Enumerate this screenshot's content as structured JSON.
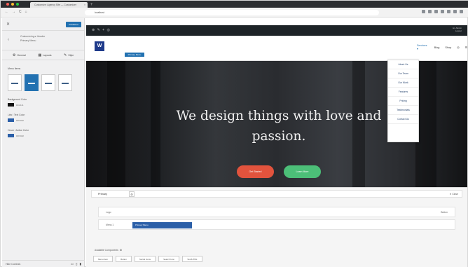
{
  "browser": {
    "tab_title": "Customize: Agency Site — Customizer",
    "tab_close": "×",
    "new_tab": "+",
    "url": "localhost",
    "nav_back": "←",
    "nav_forward": "→",
    "nav_reload": "C",
    "nav_home": "⌂",
    "traffic_colors": [
      "#ff5f57",
      "#febc2e",
      "#28c840"
    ]
  },
  "customizer": {
    "close": "✕",
    "publish_label": "Published",
    "back": "‹",
    "title_line1": "Customizing ▸ Header",
    "title_line2": "Primary Menu",
    "tabs": [
      {
        "icon": "⚙",
        "label": "General"
      },
      {
        "icon": "▦",
        "label": "Layouts"
      },
      {
        "icon": "✎",
        "label": "Style"
      }
    ],
    "section_label": "Menu Items",
    "devices_selected": 1,
    "color_settings": [
      {
        "label": "Background Color",
        "color": "#111111",
        "value": "#111111"
      },
      {
        "label": "Link / Text Color",
        "color": "#2b5fa8",
        "value": "#2b5fa8"
      },
      {
        "label": "Hover / Active Color",
        "color": "#2b5fa8",
        "value": "#2b5fa8"
      }
    ],
    "footer": {
      "hide_controls": "Hide Controls",
      "desktop_icon": "▭",
      "tablet_icon": "▯",
      "mobile_icon": "▮"
    }
  },
  "admin_bar": {
    "wp": "⊕ ✎ + ◎",
    "howdy_line1": "Hi, Admin",
    "howdy_line2": "Logout"
  },
  "site": {
    "logo": "W",
    "menu_tooltip": "Primary Menu",
    "nav": [
      {
        "label": "Services ▾",
        "active": true
      },
      {
        "label": "Blog",
        "active": false
      },
      {
        "label": "Shop",
        "active": false
      },
      {
        "label": "◎",
        "active": false
      },
      {
        "label": "☰",
        "active": false
      }
    ],
    "dropdown": [
      "About Us",
      "Our Team",
      "Our Work",
      "Features",
      "Pricing",
      "Testimonials",
      "Contact Us"
    ],
    "hero_headline": "We design things with love and passion.",
    "btn_primary": "Get Started",
    "btn_secondary": "Learn More"
  },
  "builder": {
    "title": "Primary",
    "gear": "⚙",
    "close": "✕ Close",
    "row1_label": "Logo",
    "row1_right": "Button",
    "row2_label": "Menu 1",
    "row2_item": "Primary Menu",
    "available_label": "Available Components",
    "available_icon": "⚙",
    "components": [
      "Menu Item",
      "Button",
      "Social Icons",
      "Search Icon",
      "Text/HTML"
    ]
  },
  "colors": {
    "accent": "#2271b1",
    "admin_bar": "#1d2327",
    "btn_red": "#e2533d",
    "btn_green": "#4cbf78"
  }
}
